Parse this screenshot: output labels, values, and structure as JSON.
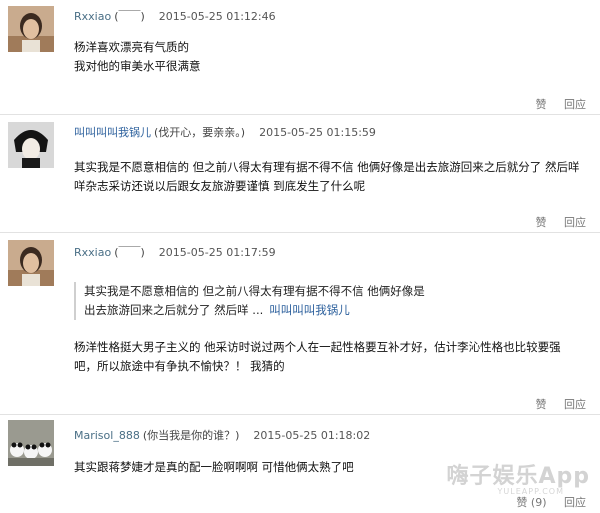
{
  "comments": [
    {
      "username": "Rxxiao",
      "suffix": "(￣￣)",
      "time": "2015-05-25 01:12:46",
      "lines": [
        "杨洋喜欢漂亮有气质的",
        "我对他的审美水平很满意"
      ],
      "like_label": "赞",
      "reply_label": "回应"
    },
    {
      "username": "叫叫叫叫我锅儿",
      "suffix": "(伐开心，要亲亲。)",
      "time": "2015-05-25 01:15:59",
      "lines": [
        "其实我是不愿意相信的 但之前八得太有理有据不得不信 他俩好像是出去旅游回来之后就分了 然后咩",
        "咩杂志采访还说以后跟女友旅游要谨慎 到底发生了什么呢"
      ],
      "like_label": "赞",
      "reply_label": "回应"
    },
    {
      "username": "Rxxiao",
      "suffix": "(￣￣)",
      "time": "2015-05-25 01:17:59",
      "quote_lines": [
        "其实我是不愿意相信的 但之前八得太有理有据不得不信 他俩好像是",
        "出去旅游回来之后就分了 然后咩 ..."
      ],
      "quote_author": "叫叫叫叫我锅儿",
      "lines": [
        "杨洋性格挺大男子主义的 他采访时说过两个人在一起性格要互补才好，估计李沁性格也比较要强",
        "吧，所以旅途中有争执不愉快？！ 我猜的"
      ],
      "like_label": "赞",
      "reply_label": "回应"
    },
    {
      "username": "Marisol_888",
      "suffix": "(你当我是你的谁？)",
      "time": "2015-05-25 01:18:02",
      "lines": [
        "其实跟蒋梦婕才是真的配一脸啊啊啊 可惜他俩太熟了吧"
      ],
      "like_label": "赞 (9)",
      "reply_label": "回应"
    }
  ],
  "watermark": {
    "text": "嗨子娱乐App",
    "sub": "YULEAPP.COM"
  }
}
